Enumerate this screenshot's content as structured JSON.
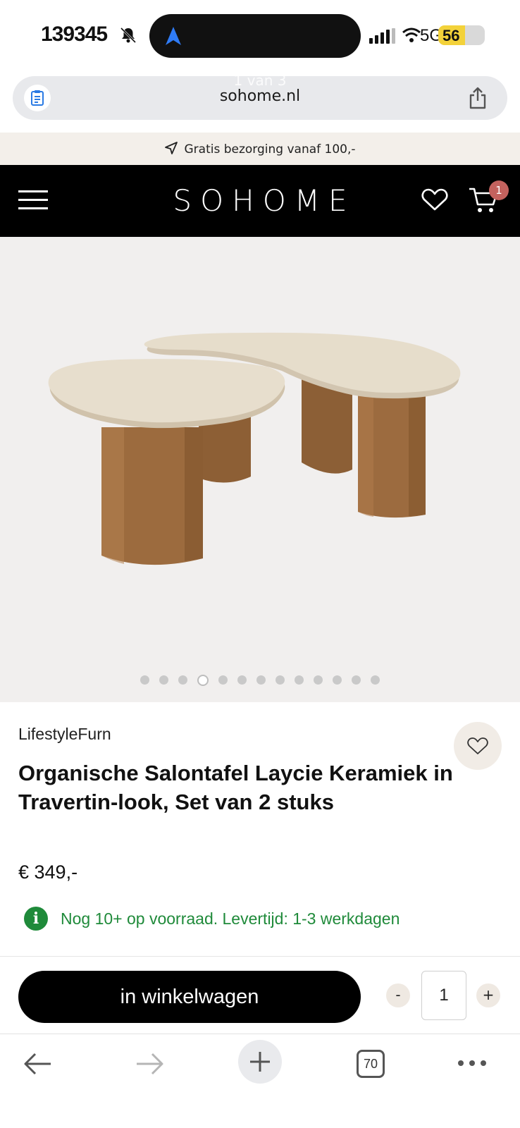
{
  "status_bar": {
    "time": "139345",
    "network": "5G",
    "battery": "56"
  },
  "url_bar": {
    "domain": "sohome.nl",
    "tab_indicator": "1 van 3"
  },
  "promo": {
    "text": "Gratis bezorging vanaf 100,-"
  },
  "header": {
    "logo": "SOHOME",
    "cart_count": "1"
  },
  "gallery": {
    "slide_count": 13,
    "active_index": 3
  },
  "product": {
    "brand": "LifestyleFurn",
    "title": "Organische Salontafel Laycie Keramiek in Travertin-look, Set van 2 stuks",
    "price": "€ 349,-",
    "stock_icon": "i",
    "stock_text": "Nog 10+ op voorraad. Levertijd: 1-3 werkdagen"
  },
  "cart_bar": {
    "add_label": "in winkelwagen",
    "minus": "-",
    "quantity": "1",
    "plus": "+"
  },
  "toolbar": {
    "tab_count": "70"
  },
  "colors": {
    "header_bg": "#000000",
    "promo_bg": "#f3efea",
    "stock_green": "#1f8a3a",
    "badge": "#c4625e",
    "travertine": "#e4dac8",
    "wood": "#9a6a3e"
  },
  "icons": [
    "bell-slash-icon",
    "navigation-arrow-icon",
    "signal-icon",
    "wifi-icon",
    "battery-icon",
    "document-icon",
    "share-icon",
    "send-icon",
    "menu-icon",
    "heart-icon",
    "cart-icon",
    "info-icon",
    "back-arrow-icon",
    "forward-arrow-icon",
    "plus-icon",
    "tabs-icon",
    "more-icon"
  ]
}
